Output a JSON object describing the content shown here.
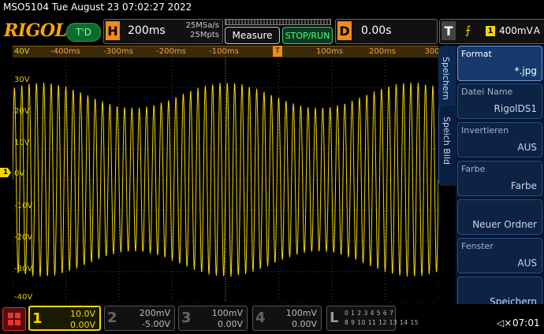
{
  "header": {
    "title": "MSO5104   Tue August 23 07:02:27 2022",
    "brand": "RIGOL",
    "trigger_status": "T'D"
  },
  "horizontal": {
    "key": "H",
    "scale": "200ms",
    "sample_rate": "25MSa/s",
    "memory_depth": "25Mpts"
  },
  "buttons": {
    "measure": "Measure",
    "stop_run": "STOP/RUN"
  },
  "delay": {
    "key": "D",
    "value": "0.00s"
  },
  "trigger": {
    "key": "T",
    "edge_icon": "rising-edge-icon",
    "edge_glyph": "⨍",
    "source": "1",
    "level": "400mV",
    "mode": "A"
  },
  "time_axis": [
    "-400ms",
    "-300ms",
    "-200ms",
    "-100ms",
    "100ms",
    "200ms",
    "300"
  ],
  "trig_marker": "T",
  "volt_axis": [
    "40V",
    "30V",
    "20V",
    "10V",
    "0V",
    "-10V",
    "-20V",
    "-30V",
    "-40V"
  ],
  "ch1_marker": "1",
  "side_tabs": {
    "save": "Speichern",
    "save_image": "Speich Bild"
  },
  "menu": [
    {
      "label": "Format",
      "value": "*.jpg"
    },
    {
      "label": "Datei Name",
      "value": "RigolDS1"
    },
    {
      "label": "Invertieren",
      "value": "AUS"
    },
    {
      "label": "Farbe",
      "value": "Farbe"
    },
    {
      "label": "",
      "value": "Neuer Ordner"
    },
    {
      "label": "Fenster",
      "value": "AUS"
    },
    {
      "label": "",
      "value": "Speichern"
    }
  ],
  "channels": [
    {
      "num": "1",
      "scale": "10.0V",
      "offset": "0.00V"
    },
    {
      "num": "2",
      "scale": "200mV",
      "offset": "-5.00V"
    },
    {
      "num": "3",
      "scale": "100mV",
      "offset": "0.00V"
    },
    {
      "num": "4",
      "scale": "100mV",
      "offset": "0.00V"
    }
  ],
  "logic": {
    "key": "L",
    "row1": "0 1 2 3   4 5 6 7",
    "row2": "8 9 10 11 12 13 14 15"
  },
  "clock": "07:01",
  "colors": {
    "ch1": "#f5d800",
    "accent": "#f08a1a",
    "run": "#4CFF86"
  }
}
